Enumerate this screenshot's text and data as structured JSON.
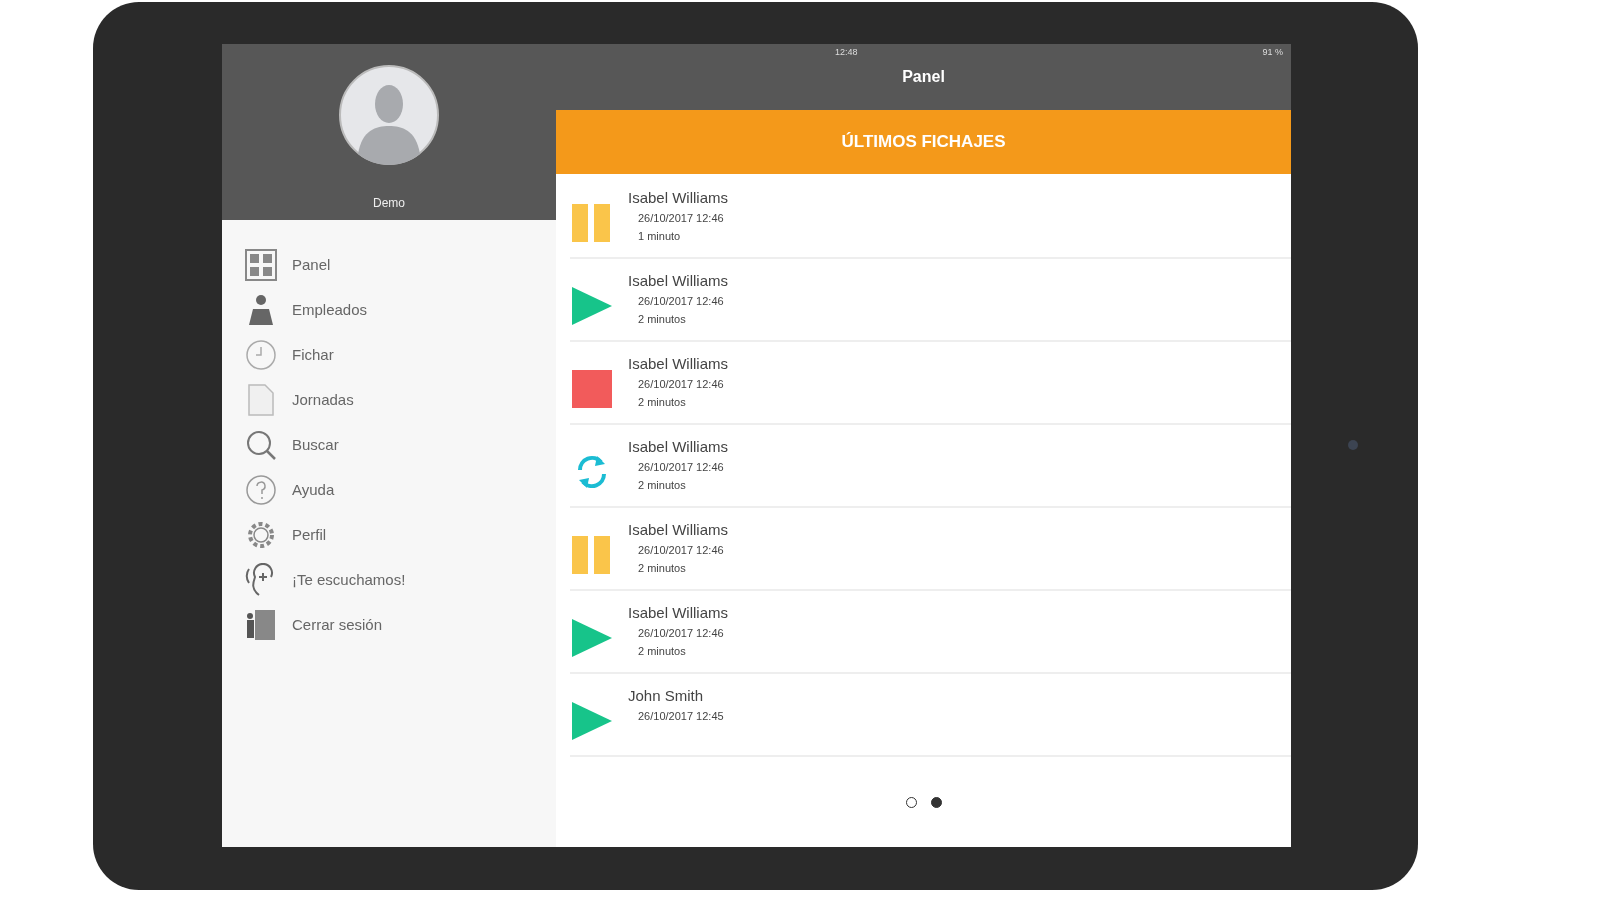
{
  "status_bar": {
    "time": "12:48",
    "battery": "91 %"
  },
  "sidebar": {
    "user": "Demo",
    "items": [
      "Panel",
      "Empleados",
      "Fichar",
      "Jornadas",
      "Buscar",
      "Ayuda",
      "Perfil",
      "¡Te escuchamos!",
      "Cerrar sesión"
    ]
  },
  "header": {
    "title": "Panel"
  },
  "banner": "ÚLTIMOS FICHAJES",
  "entries": [
    {
      "kind": "pause",
      "name": "Isabel Williams",
      "date": "26/10/2017 12:46",
      "duration": "1 minuto"
    },
    {
      "kind": "play",
      "name": "Isabel Williams",
      "date": "26/10/2017 12:46",
      "duration": "2 minutos"
    },
    {
      "kind": "stop",
      "name": "Isabel Williams",
      "date": "26/10/2017 12:46",
      "duration": "2 minutos"
    },
    {
      "kind": "sync",
      "name": "Isabel Williams",
      "date": "26/10/2017 12:46",
      "duration": "2 minutos"
    },
    {
      "kind": "pause",
      "name": "Isabel Williams",
      "date": "26/10/2017 12:46",
      "duration": "2 minutos"
    },
    {
      "kind": "play",
      "name": "Isabel Williams",
      "date": "26/10/2017 12:46",
      "duration": "2 minutos"
    },
    {
      "kind": "play",
      "name": "John Smith",
      "date": "26/10/2017 12:45"
    }
  ],
  "pager": [
    {
      "selected": false
    },
    {
      "selected": true
    }
  ]
}
